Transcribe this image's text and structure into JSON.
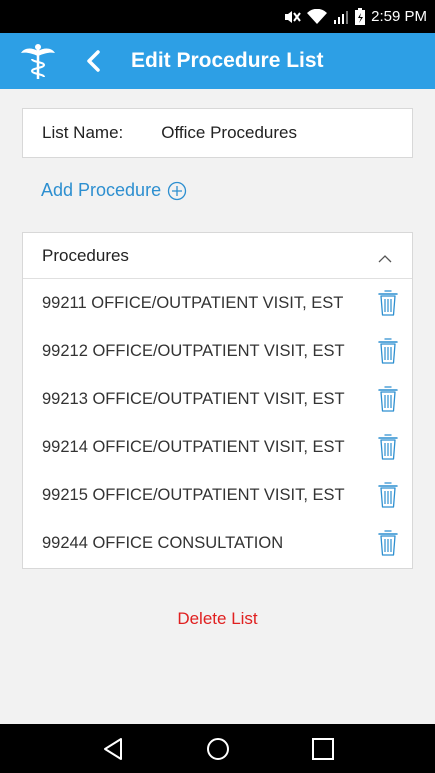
{
  "status_bar": {
    "time": "2:59 PM"
  },
  "app_bar": {
    "title": "Edit Procedure List",
    "back_icon": "back-chevron-icon",
    "logo_icon": "caduceus-icon"
  },
  "list_name": {
    "label": "List Name:",
    "value": "Office Procedures"
  },
  "add_procedure": {
    "label": "Add Procedure",
    "icon": "plus-circle-icon"
  },
  "procedures": {
    "header": "Procedures",
    "items": [
      {
        "label": "99211 OFFICE/OUTPATIENT VISIT, EST"
      },
      {
        "label": "99212 OFFICE/OUTPATIENT VISIT, EST"
      },
      {
        "label": "99213 OFFICE/OUTPATIENT VISIT, EST"
      },
      {
        "label": "99214 OFFICE/OUTPATIENT VISIT, EST"
      },
      {
        "label": "99215 OFFICE/OUTPATIENT VISIT, EST"
      },
      {
        "label": "99244 OFFICE CONSULTATION"
      }
    ]
  },
  "delete_list": {
    "label": "Delete List"
  },
  "colors": {
    "accent": "#2d9fe5",
    "link": "#2d8fd0",
    "danger": "#e02020"
  }
}
